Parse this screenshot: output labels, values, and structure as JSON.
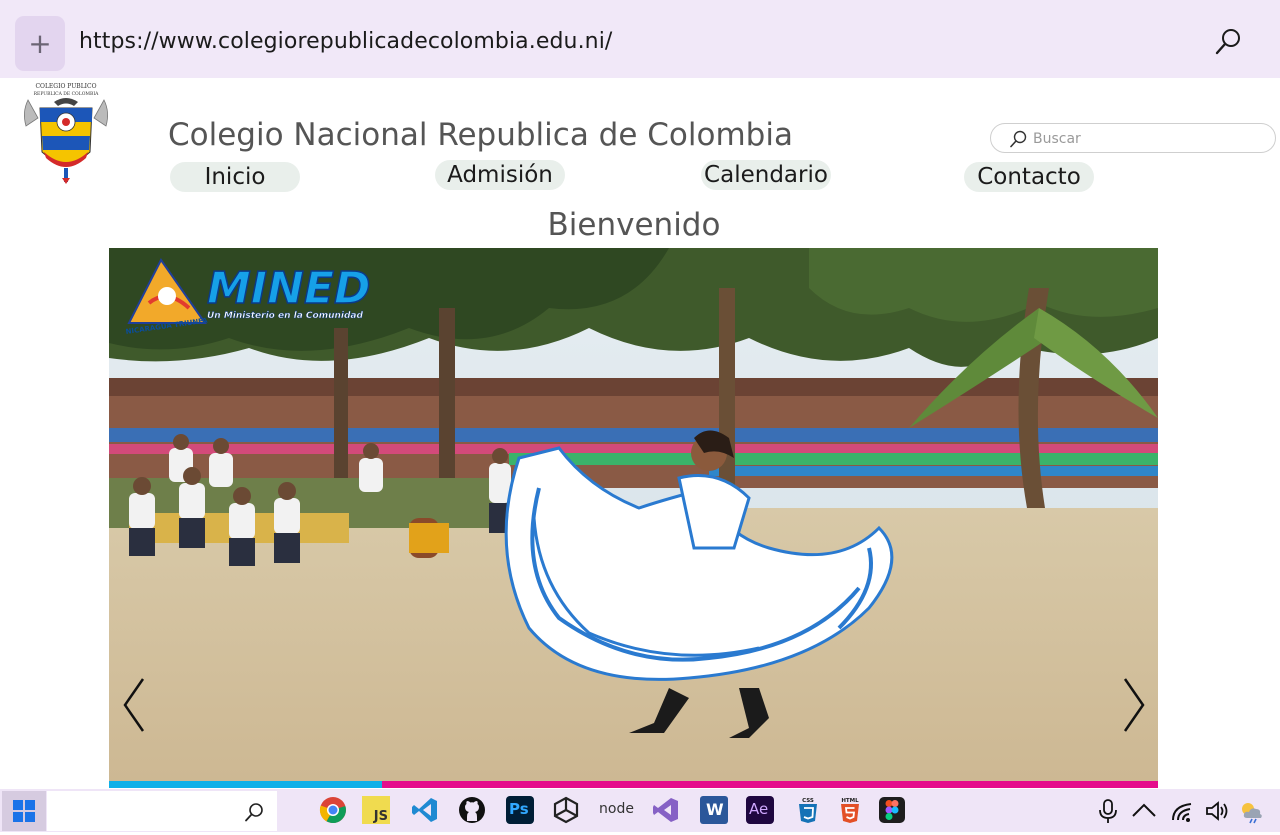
{
  "browser": {
    "new_tab_label": "+",
    "url": "https://www.colegiorepublicadecolombia.edu.ni/"
  },
  "site": {
    "logo_text_top": "COLEGIO PUBLICO",
    "logo_text_bottom": "REPUBLICA DE COLOMBIA",
    "title": "Colegio Nacional Republica de Colombia",
    "search_placeholder": "Buscar",
    "nav": [
      "Inicio",
      "Admisión",
      "Calendario",
      "Contacto"
    ],
    "welcome": "Bienvenido"
  },
  "hero": {
    "watermark_brand": "MINED",
    "watermark_tagline": "Un Ministerio en la Comunidad",
    "watermark_seal_text": "NICARAGUA TRIUNFA",
    "slide_progress": 0.26
  },
  "taskbar": {
    "apps": [
      "chrome-icon",
      "javascript-icon",
      "vscode-icon",
      "github-icon",
      "photoshop-icon",
      "unity-icon",
      "nodejs-icon",
      "visual-studio-icon",
      "word-icon",
      "after-effects-icon",
      "css3-icon",
      "html5-icon",
      "figma-icon"
    ],
    "labels": {
      "js": "JS",
      "ps": "Ps",
      "node": "node",
      "word": "W",
      "ae": "Ae",
      "css": "CSS",
      "html": "HTML"
    }
  },
  "colors": {
    "browser_bar": "#f1e8f8",
    "nav_pill": "#e9efeb",
    "progress_active": "#0fb0e8",
    "progress_rest": "#e50e8c"
  }
}
